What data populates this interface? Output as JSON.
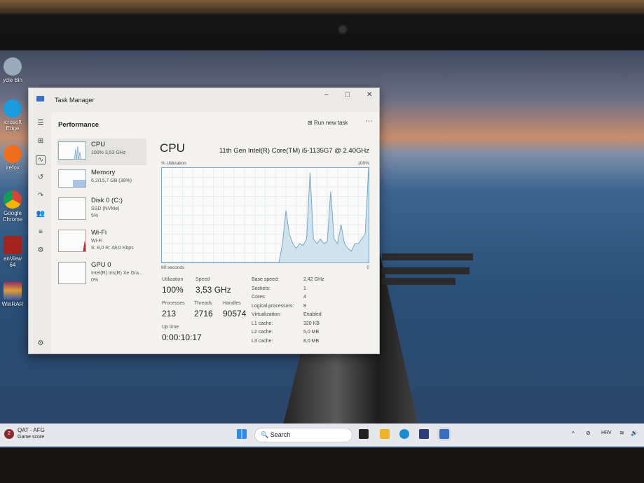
{
  "desktop": {
    "icons": [
      "ycle Bin",
      "icrosoft Edge",
      "irefox",
      "Google Chrome",
      "anView 64",
      "WinRAR"
    ]
  },
  "window": {
    "title": "Task Manager",
    "minimize": "–",
    "maximize": "□",
    "close": "✕"
  },
  "header": {
    "title": "Performance",
    "run_new_task": "Run new task",
    "more": "···"
  },
  "sidebar": [
    {
      "name": "CPU",
      "sub1": "100% 3,53 GHz",
      "sub2": ""
    },
    {
      "name": "Memory",
      "sub1": "6,2/15,7 GB (39%)",
      "sub2": ""
    },
    {
      "name": "Disk 0 (C:)",
      "sub1": "SSD (NVMe)",
      "sub2": "5%"
    },
    {
      "name": "Wi-Fi",
      "sub1": "Wi-Fi",
      "sub2": "S: 8,0 R: 48,0 Kbps"
    },
    {
      "name": "GPU 0",
      "sub1": "Intel(R) Iris(R) Xe Gra...",
      "sub2": "0%"
    }
  ],
  "main": {
    "title": "CPU",
    "model": "11th Gen Intel(R) Core(TM) i5-1135G7 @ 2.40GHz",
    "util_label": "% Utilization",
    "max_label": "100%",
    "time_label": "60 seconds",
    "min_label": "0"
  },
  "stats": {
    "utilization_label": "Utilization",
    "utilization": "100%",
    "speed_label": "Speed",
    "speed": "3,53 GHz",
    "processes_label": "Processes",
    "processes": "213",
    "threads_label": "Threads",
    "threads": "2716",
    "handles_label": "Handles",
    "handles": "90574",
    "uptime_label": "Up time",
    "uptime": "0:00:10:17"
  },
  "specs": [
    {
      "k": "Base speed:",
      "v": "2,42 GHz"
    },
    {
      "k": "Sockets:",
      "v": "1"
    },
    {
      "k": "Cores:",
      "v": "4"
    },
    {
      "k": "Logical processors:",
      "v": "8"
    },
    {
      "k": "Virtualization:",
      "v": "Enabled"
    },
    {
      "k": "L1 cache:",
      "v": "320 KB"
    },
    {
      "k": "L2 cache:",
      "v": "5,0 MB"
    },
    {
      "k": "L3 cache:",
      "v": "8,0 MB"
    }
  ],
  "chart_data": {
    "type": "area",
    "title": "CPU % Utilization",
    "xlabel": "60 seconds",
    "ylim": [
      0,
      100
    ],
    "x": [
      0,
      34,
      35,
      36,
      37,
      38,
      39,
      40,
      41,
      42,
      43,
      44,
      45,
      46,
      47,
      48,
      49,
      50,
      51,
      52,
      53,
      54,
      55,
      56,
      57,
      58,
      59,
      60
    ],
    "values": [
      0,
      0,
      20,
      55,
      30,
      20,
      15,
      20,
      18,
      25,
      95,
      25,
      20,
      25,
      20,
      22,
      75,
      25,
      20,
      40,
      20,
      15,
      12,
      20,
      20,
      25,
      30,
      100
    ]
  },
  "taskbar": {
    "weather_title": "QAT - AFG",
    "weather_sub": "Game score",
    "badge": "2",
    "search": "Search",
    "lang": "HRV",
    "chevron": "^"
  },
  "colors": {
    "accent": "#7aa7c7",
    "fill": "#cfe3ef"
  }
}
